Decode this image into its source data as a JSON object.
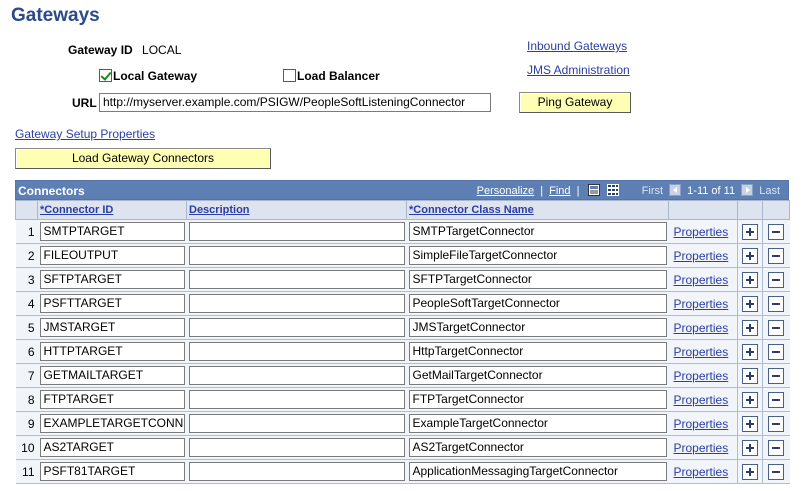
{
  "page": {
    "title": "Gateways"
  },
  "gateway": {
    "id_label": "Gateway ID",
    "id_value": "LOCAL",
    "local_gateway_label": "Local Gateway",
    "local_gateway_checked": true,
    "load_balancer_label": "Load Balancer",
    "load_balancer_checked": false,
    "url_label": "URL",
    "url_value": "http://myserver.example.com/PSIGW/PeopleSoftListeningConnector",
    "ping_button": "Ping Gateway",
    "setup_properties_link": "Gateway Setup Properties",
    "load_connectors_button": "Load Gateway Connectors"
  },
  "links": {
    "inbound_gateways": "Inbound Gateways",
    "jms_administration": "JMS Administration"
  },
  "grid": {
    "title": "Connectors",
    "personalize": "Personalize",
    "find": "Find",
    "first": "First",
    "range": "1-11 of 11",
    "last": "Last",
    "sep": "|",
    "columns": {
      "connector_id": "*Connector ID",
      "description": "Description",
      "class_name": "*Connector Class Name"
    },
    "properties_label": "Properties",
    "rows": [
      {
        "num": "1",
        "connector_id": "SMTPTARGET",
        "description": "",
        "class_name": "SMTPTargetConnector"
      },
      {
        "num": "2",
        "connector_id": "FILEOUTPUT",
        "description": "",
        "class_name": "SimpleFileTargetConnector"
      },
      {
        "num": "3",
        "connector_id": "SFTPTARGET",
        "description": "",
        "class_name": "SFTPTargetConnector"
      },
      {
        "num": "4",
        "connector_id": "PSFTTARGET",
        "description": "",
        "class_name": "PeopleSoftTargetConnector"
      },
      {
        "num": "5",
        "connector_id": "JMSTARGET",
        "description": "",
        "class_name": "JMSTargetConnector"
      },
      {
        "num": "6",
        "connector_id": "HTTPTARGET",
        "description": "",
        "class_name": "HttpTargetConnector"
      },
      {
        "num": "7",
        "connector_id": "GETMAILTARGET",
        "description": "",
        "class_name": "GetMailTargetConnector"
      },
      {
        "num": "8",
        "connector_id": "FTPTARGET",
        "description": "",
        "class_name": "FTPTargetConnector"
      },
      {
        "num": "9",
        "connector_id": "EXAMPLETARGETCONNE",
        "description": "",
        "class_name": "ExampleTargetConnector"
      },
      {
        "num": "10",
        "connector_id": "AS2TARGET",
        "description": "",
        "class_name": "AS2TargetConnector"
      },
      {
        "num": "11",
        "connector_id": "PSFT81TARGET",
        "description": "",
        "class_name": "ApplicationMessagingTargetConnector"
      }
    ]
  },
  "colors": {
    "title_blue": "#2c4b87",
    "link_blue": "#2a3ea4",
    "grid_header": "#5e7fb3",
    "button_yellow": "#ffffb4"
  }
}
